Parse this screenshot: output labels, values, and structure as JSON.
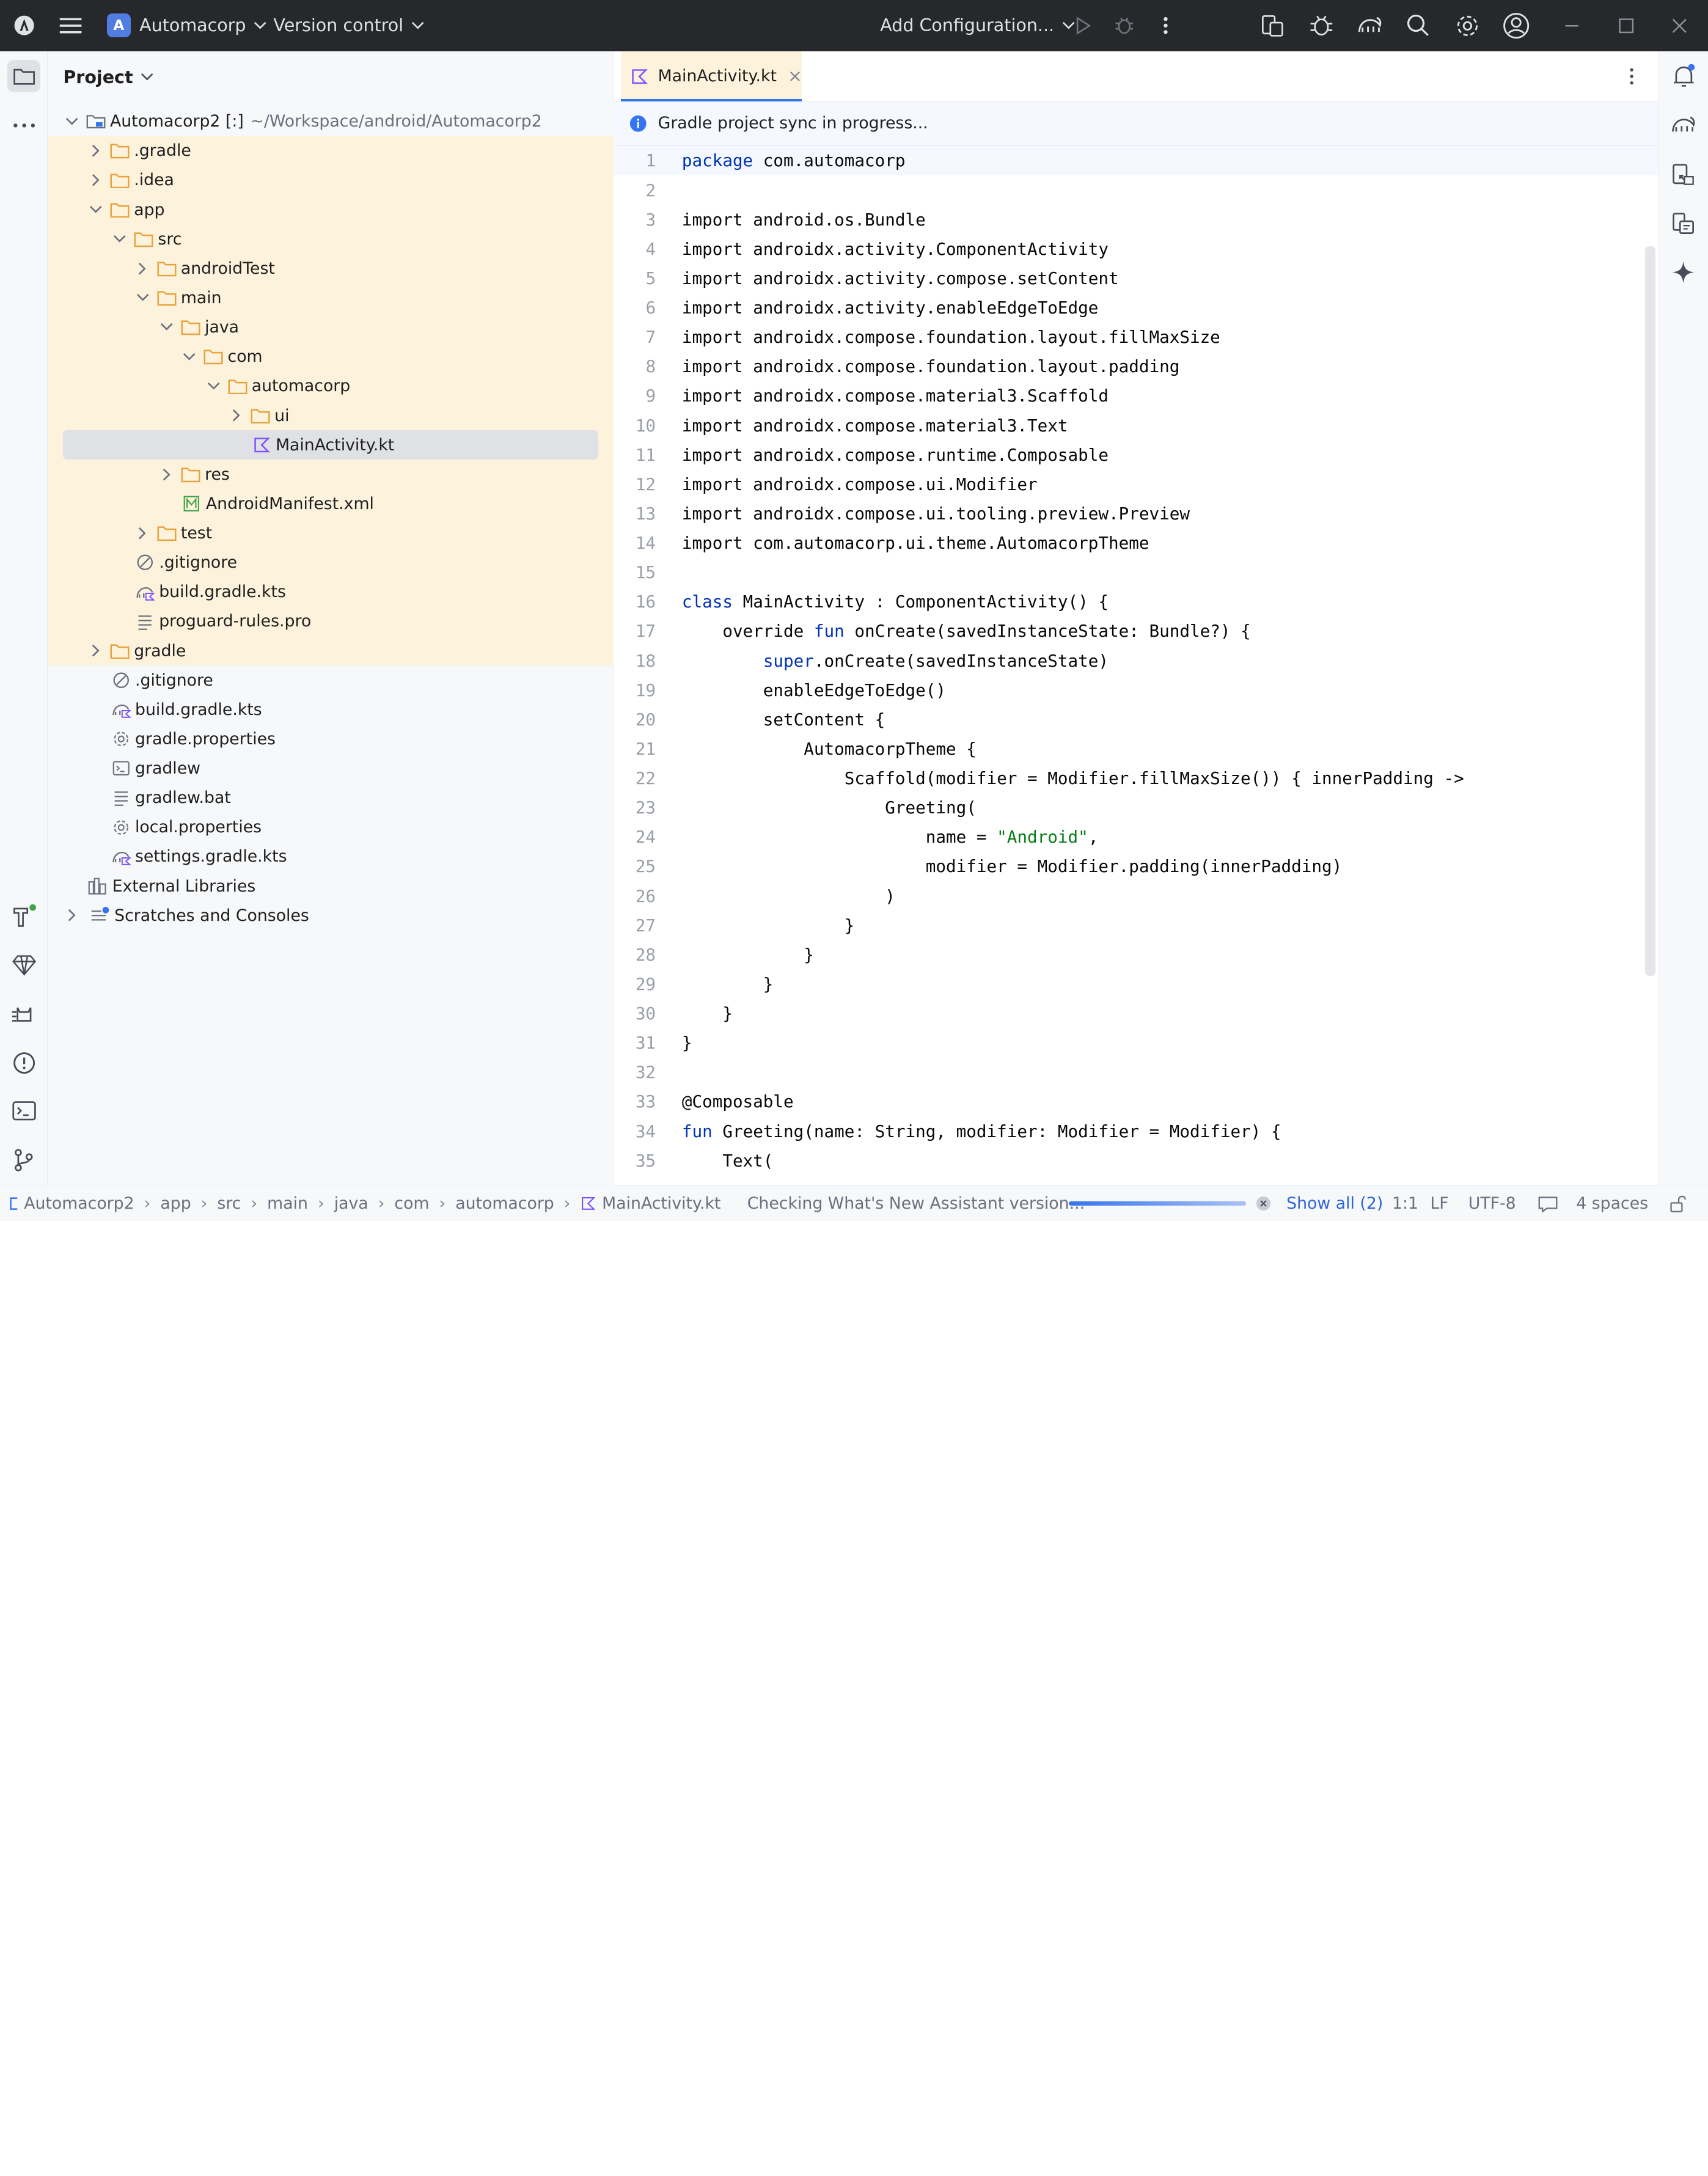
{
  "titlebar": {
    "project_initial": "A",
    "project_name": "Automacorp",
    "vcs_label": "Version control",
    "config_label": "Add Configuration..."
  },
  "project_panel": {
    "title": "Project",
    "root": {
      "label": "Automacorp2 [:]",
      "path": "~/Workspace/android/Automacorp2"
    },
    "items": [
      {
        "label": ".gradle"
      },
      {
        "label": ".idea"
      },
      {
        "label": "app"
      },
      {
        "label": "src"
      },
      {
        "label": "androidTest"
      },
      {
        "label": "main"
      },
      {
        "label": "java"
      },
      {
        "label": "com"
      },
      {
        "label": "automacorp"
      },
      {
        "label": "ui"
      },
      {
        "label": "MainActivity.kt"
      },
      {
        "label": "res"
      },
      {
        "label": "AndroidManifest.xml"
      },
      {
        "label": "test"
      },
      {
        "label": ".gitignore"
      },
      {
        "label": "build.gradle.kts"
      },
      {
        "label": "proguard-rules.pro"
      },
      {
        "label": "gradle"
      },
      {
        "label": ".gitignore"
      },
      {
        "label": "build.gradle.kts"
      },
      {
        "label": "gradle.properties"
      },
      {
        "label": "gradlew"
      },
      {
        "label": "gradlew.bat"
      },
      {
        "label": "local.properties"
      },
      {
        "label": "settings.gradle.kts"
      },
      {
        "label": "External Libraries"
      },
      {
        "label": "Scratches and Consoles"
      }
    ]
  },
  "editor": {
    "tab_label": "MainActivity.kt",
    "sync_message": "Gradle project sync in progress...",
    "lines": [
      {
        "n": "1",
        "t": "package com.automacorp"
      },
      {
        "n": "2",
        "t": ""
      },
      {
        "n": "3",
        "t": "import android.os.Bundle"
      },
      {
        "n": "4",
        "t": "import androidx.activity.ComponentActivity"
      },
      {
        "n": "5",
        "t": "import androidx.activity.compose.setContent"
      },
      {
        "n": "6",
        "t": "import androidx.activity.enableEdgeToEdge"
      },
      {
        "n": "7",
        "t": "import androidx.compose.foundation.layout.fillMaxSize"
      },
      {
        "n": "8",
        "t": "import androidx.compose.foundation.layout.padding"
      },
      {
        "n": "9",
        "t": "import androidx.compose.material3.Scaffold"
      },
      {
        "n": "10",
        "t": "import androidx.compose.material3.Text"
      },
      {
        "n": "11",
        "t": "import androidx.compose.runtime.Composable"
      },
      {
        "n": "12",
        "t": "import androidx.compose.ui.Modifier"
      },
      {
        "n": "13",
        "t": "import androidx.compose.ui.tooling.preview.Preview"
      },
      {
        "n": "14",
        "t": "import com.automacorp.ui.theme.AutomacorpTheme"
      },
      {
        "n": "15",
        "t": ""
      },
      {
        "n": "16",
        "t": "class MainActivity : ComponentActivity() {"
      },
      {
        "n": "17",
        "t": "    override fun onCreate(savedInstanceState: Bundle?) {"
      },
      {
        "n": "18",
        "t": "        super.onCreate(savedInstanceState)"
      },
      {
        "n": "19",
        "t": "        enableEdgeToEdge()"
      },
      {
        "n": "20",
        "t": "        setContent {"
      },
      {
        "n": "21",
        "t": "            AutomacorpTheme {"
      },
      {
        "n": "22",
        "t": "                Scaffold(modifier = Modifier.fillMaxSize()) { innerPadding ->"
      },
      {
        "n": "23",
        "t": "                    Greeting("
      },
      {
        "n": "24",
        "t": "                        name = \"Android\","
      },
      {
        "n": "25",
        "t": "                        modifier = Modifier.padding(innerPadding)"
      },
      {
        "n": "26",
        "t": "                    )"
      },
      {
        "n": "27",
        "t": "                }"
      },
      {
        "n": "28",
        "t": "            }"
      },
      {
        "n": "29",
        "t": "        }"
      },
      {
        "n": "30",
        "t": "    }"
      },
      {
        "n": "31",
        "t": "}"
      },
      {
        "n": "32",
        "t": ""
      },
      {
        "n": "33",
        "t": "@Composable"
      },
      {
        "n": "34",
        "t": "fun Greeting(name: String, modifier: Modifier = Modifier) {"
      },
      {
        "n": "35",
        "t": "    Text("
      }
    ]
  },
  "statusbar": {
    "breadcrumbs": [
      "Automacorp2",
      "app",
      "src",
      "main",
      "java",
      "com",
      "automacorp",
      "MainActivity.kt"
    ],
    "task": "Checking What's New Assistant version...",
    "show_all": "Show all (2)",
    "position": "1:1",
    "line_sep": "LF",
    "encoding": "UTF-8",
    "indent": "4 spaces"
  },
  "colors": {
    "titlebar_bg": "#27282c",
    "accent": "#3574f0",
    "highlight_bg": "#fdf3dc",
    "keyword": "#0033b3",
    "string": "#067d17",
    "kotlin_icon": "#7f52ff",
    "folder_icon": "#e8a33d"
  }
}
